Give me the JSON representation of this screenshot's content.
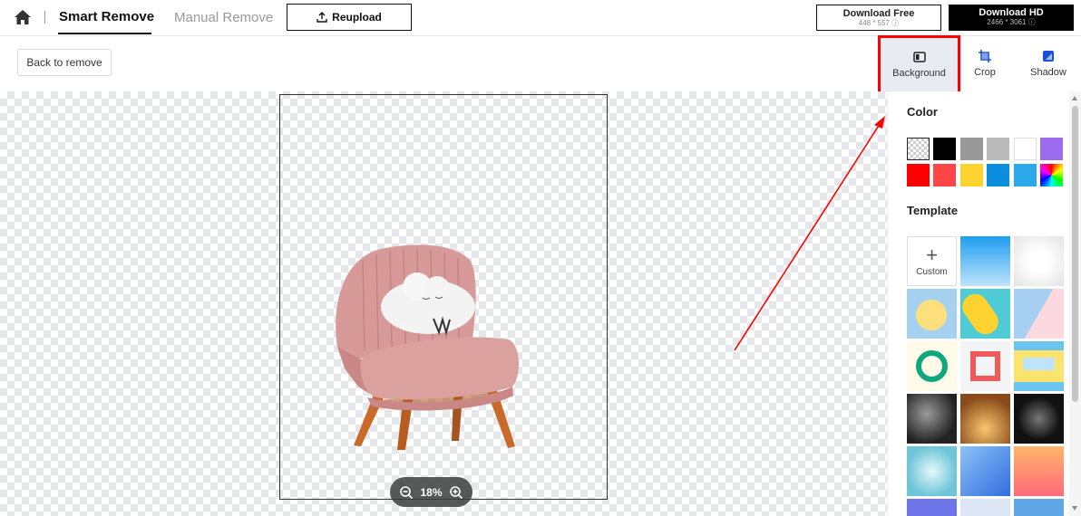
{
  "header": {
    "home_icon": "home-icon",
    "tabs": [
      {
        "label": "Smart Remove",
        "active": true
      },
      {
        "label": "Manual Remove",
        "active": false
      }
    ],
    "reupload_label": "Reupload",
    "download_free": {
      "label": "Download Free",
      "size": "448 * 557"
    },
    "download_hd": {
      "label": "Download HD",
      "size": "2466 * 3061"
    }
  },
  "toolbar": {
    "back_label": "Back to remove",
    "tools": [
      {
        "label": "Background",
        "icon": "background-icon",
        "selected": true
      },
      {
        "label": "Crop",
        "icon": "crop-icon"
      },
      {
        "label": "Shadow",
        "icon": "shadow-icon"
      }
    ]
  },
  "canvas": {
    "zoom_level": "18%"
  },
  "panel": {
    "color_title": "Color",
    "colors": [
      "transparent",
      "#000000",
      "#999999",
      "#bbbbbb",
      "#ffffff",
      "#9b6cf0",
      "#ff0000",
      "#ff4545",
      "#fed330",
      "#0b8ee0",
      "#2ca9ea",
      "rainbow"
    ],
    "template_title": "Template",
    "custom_label": "Custom"
  },
  "colors": {
    "accent_red": "#ff0000",
    "selected_tool_bg": "#e8ebf2"
  }
}
